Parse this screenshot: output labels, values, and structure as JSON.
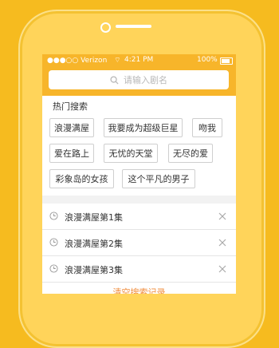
{
  "status_bar": {
    "carrier": "Verizon",
    "time": "4:21 PM",
    "battery": "100%"
  },
  "search": {
    "placeholder": "请输入剧名"
  },
  "hot": {
    "title": "热门搜索",
    "tags": [
      "浪漫满屋",
      "我要成为超级巨星",
      "吻我",
      "爱在路上",
      "无忧的天堂",
      "无尽的爱",
      "彩象岛的女孩",
      "这个平凡的男子"
    ]
  },
  "history": {
    "items": [
      "浪漫满屋第1集",
      "浪漫满屋第2集",
      "浪漫满屋第3集"
    ],
    "clear_label": "清空搜索记录"
  },
  "colors": {
    "background": "#f6bb1f",
    "bar": "#f7b52a",
    "accent": "#f08c3b"
  }
}
